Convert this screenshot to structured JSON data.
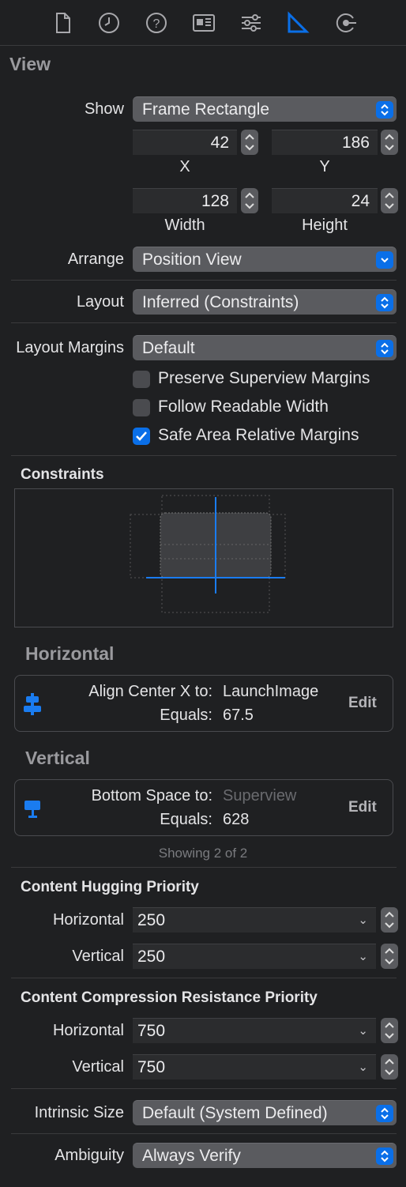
{
  "toolbar": {
    "icons": [
      "file-icon",
      "clock-icon",
      "help-icon",
      "id-card-icon",
      "sliders-icon",
      "ruler-icon",
      "connections-icon"
    ],
    "active": "ruler-icon"
  },
  "view": {
    "title": "View",
    "show_label": "Show",
    "show_value": "Frame Rectangle",
    "x_value": "42",
    "x_label": "X",
    "y_value": "186",
    "y_label": "Y",
    "width_value": "128",
    "width_label": "Width",
    "height_value": "24",
    "height_label": "Height",
    "arrange_label": "Arrange",
    "arrange_value": "Position View",
    "layout_label": "Layout",
    "layout_value": "Inferred (Constraints)",
    "margins_label": "Layout Margins",
    "margins_value": "Default",
    "preserve_label": "Preserve Superview Margins",
    "preserve_checked": false,
    "readable_label": "Follow Readable Width",
    "readable_checked": false,
    "safe_label": "Safe Area Relative Margins",
    "safe_checked": true
  },
  "constraints": {
    "title": "Constraints",
    "horizontal_title": "Horizontal",
    "horizontal": {
      "line1_label": "Align Center X to:",
      "line1_value": "LaunchImage",
      "line2_label": "Equals:",
      "line2_value": "67.5",
      "edit": "Edit"
    },
    "vertical_title": "Vertical",
    "vertical": {
      "line1_label": "Bottom Space to:",
      "line1_value": "Superview",
      "line2_label": "Equals:",
      "line2_value": "628",
      "edit": "Edit"
    },
    "showing": "Showing 2 of 2"
  },
  "hugging": {
    "title": "Content Hugging Priority",
    "h_label": "Horizontal",
    "h_value": "250",
    "v_label": "Vertical",
    "v_value": "250"
  },
  "compression": {
    "title": "Content Compression Resistance Priority",
    "h_label": "Horizontal",
    "h_value": "750",
    "v_label": "Vertical",
    "v_value": "750"
  },
  "intrinsic": {
    "label": "Intrinsic Size",
    "value": "Default (System Defined)"
  },
  "ambiguity": {
    "label": "Ambiguity",
    "value": "Always Verify"
  },
  "colors": {
    "accent": "#0a6fe8",
    "background": "#1f2022"
  }
}
